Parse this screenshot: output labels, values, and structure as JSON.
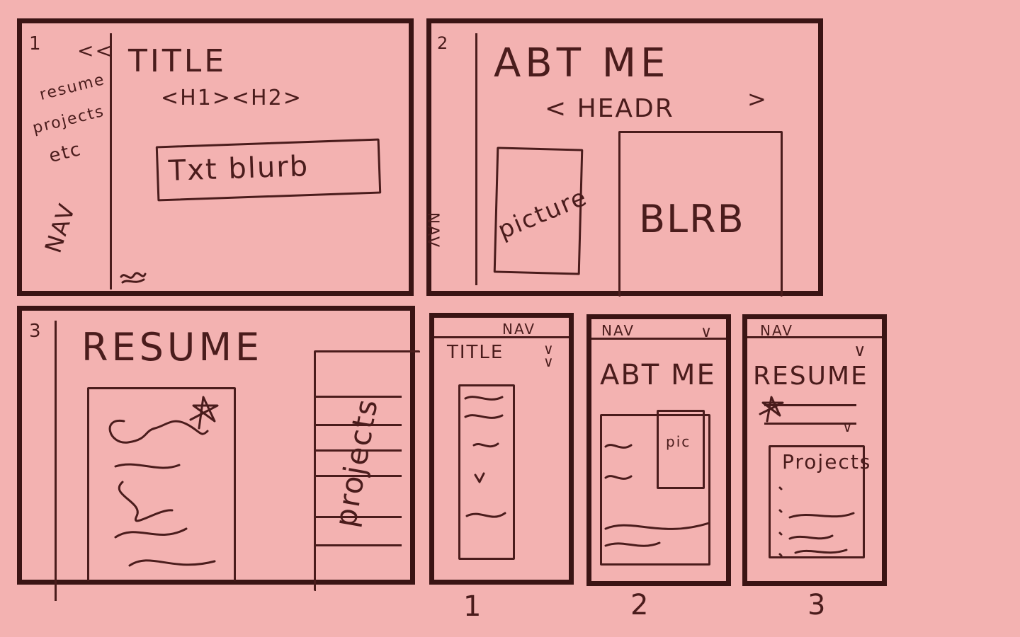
{
  "panel1": {
    "number": "1",
    "back_arrow": "<<",
    "nav_items": [
      "resume",
      "projects",
      "etc"
    ],
    "nav_label": "NAV",
    "title": "TITLE",
    "headings": "<H1><H2>",
    "text_box": "Txt blurb"
  },
  "panel2": {
    "number": "2",
    "title": "ABT ME",
    "header": "< HEADR",
    "header_close": ">",
    "nav_label": "NAV",
    "picture": "picture",
    "blurb": "BLRB"
  },
  "panel3": {
    "number": "3",
    "title": "RESUME",
    "projects_label": "projects"
  },
  "mobile1": {
    "nav": "NAV",
    "title": "TITLE",
    "caption": "1"
  },
  "mobile2": {
    "nav": "NAV",
    "title": "ABT ME",
    "pic": "pic",
    "caption": "2"
  },
  "mobile3": {
    "nav": "NAV",
    "title": "RESUME",
    "projects": "Projects",
    "caption": "3"
  },
  "colors": {
    "background": "#f3b2b1",
    "ink": "#3a1414"
  }
}
